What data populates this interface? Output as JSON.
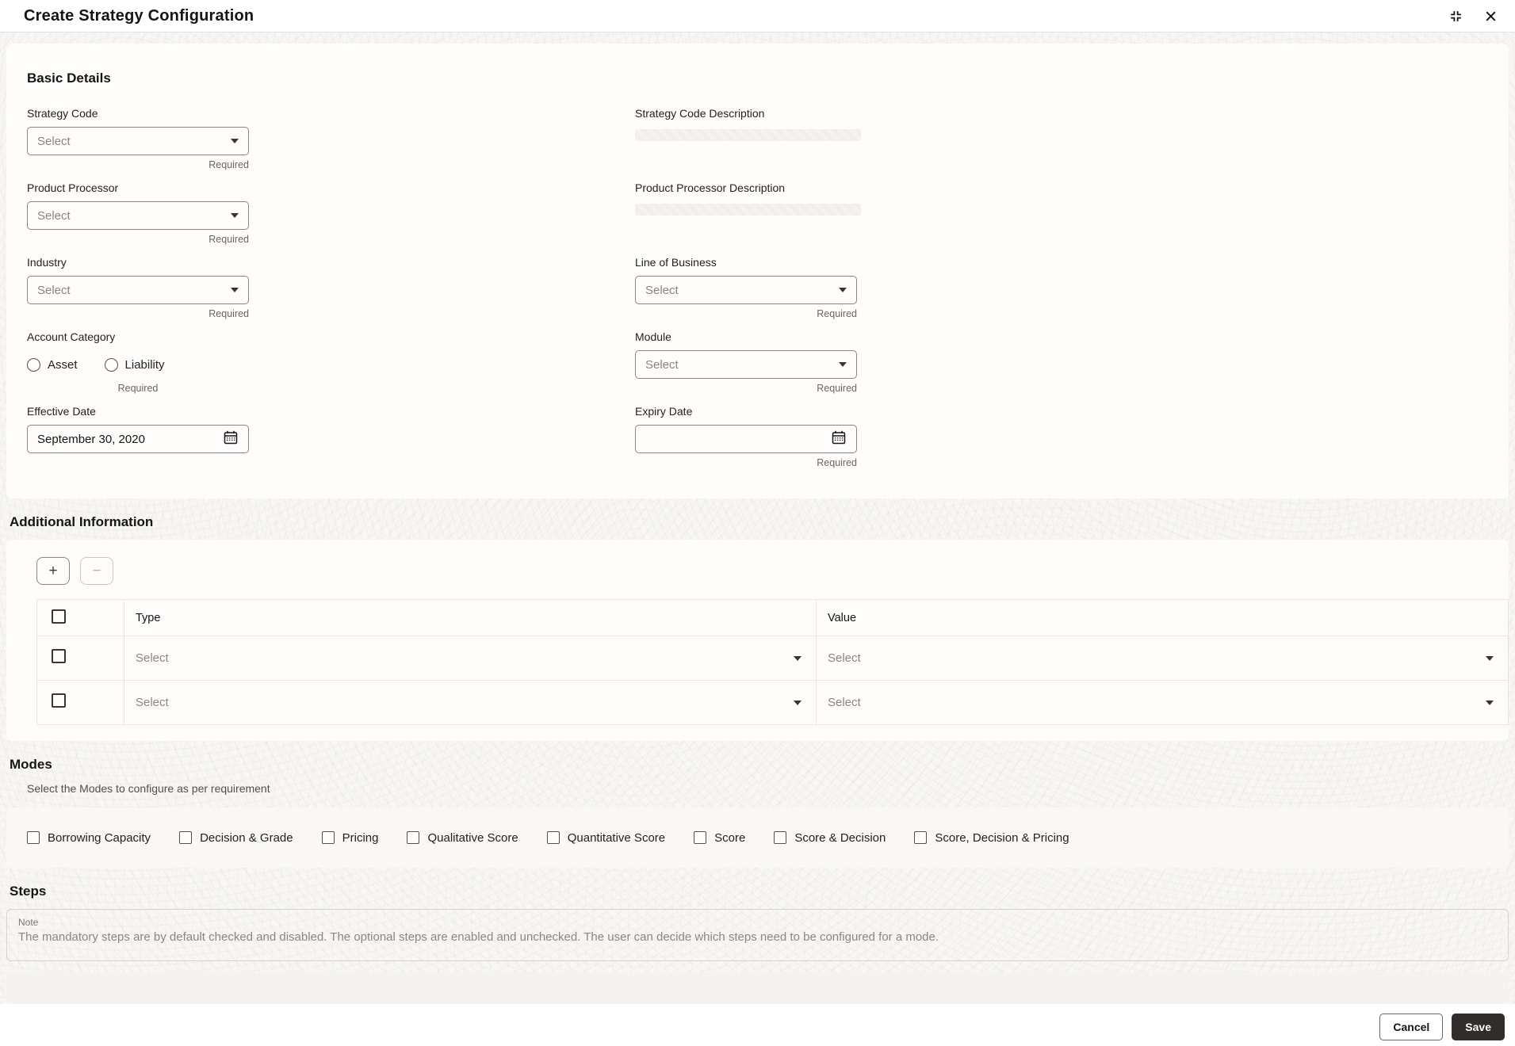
{
  "header": {
    "title": "Create Strategy Configuration"
  },
  "icons": {
    "collapse": "collapse-panel-icon",
    "close": "close-icon",
    "calendar": "calendar-icon",
    "caret": "chevron-down-icon"
  },
  "basic": {
    "title": "Basic Details",
    "required": "Required",
    "fields": {
      "strategy_code": {
        "label": "Strategy Code",
        "placeholder": "Select"
      },
      "strategy_code_description": {
        "label": "Strategy Code Description",
        "value": ""
      },
      "product_processor": {
        "label": "Product Processor",
        "placeholder": "Select"
      },
      "product_processor_description": {
        "label": "Product Processor Description",
        "value": ""
      },
      "industry": {
        "label": "Industry",
        "placeholder": "Select"
      },
      "line_of_business": {
        "label": "Line of Business",
        "placeholder": "Select"
      },
      "account_category": {
        "label": "Account Category",
        "options": [
          "Asset",
          "Liability"
        ]
      },
      "module": {
        "label": "Module",
        "placeholder": "Select"
      },
      "effective_date": {
        "label": "Effective Date",
        "value": "September 30, 2020"
      },
      "expiry_date": {
        "label": "Expiry Date",
        "value": ""
      }
    }
  },
  "additional": {
    "title": "Additional Information",
    "add_button": "+",
    "remove_button": "−",
    "columns": {
      "type": "Type",
      "value": "Value"
    },
    "rows": [
      {
        "type": "Select",
        "value": "Select"
      },
      {
        "type": "Select",
        "value": "Select"
      }
    ]
  },
  "modes": {
    "title": "Modes",
    "description": "Select the Modes to configure as per requirement",
    "options": [
      "Borrowing Capacity",
      "Decision & Grade",
      "Pricing",
      "Qualitative Score",
      "Quantitative Score",
      "Score",
      "Score & Decision",
      "Score, Decision & Pricing"
    ]
  },
  "steps": {
    "title": "Steps",
    "note_label": "Note",
    "note_text": "The mandatory steps are by default checked and disabled. The optional steps are enabled and unchecked. The user can decide which steps need to be configured for a mode."
  },
  "footer": {
    "cancel": "Cancel",
    "save": "Save"
  },
  "colors": {
    "save_button_bg": "#312d2a",
    "text_primary": "#161513",
    "text_muted": "#6b6660",
    "placeholder": "#8b857e",
    "field_border": "#8b857e",
    "grid_border": "#e9e6e2",
    "page_bg": "#f8f7f5"
  }
}
